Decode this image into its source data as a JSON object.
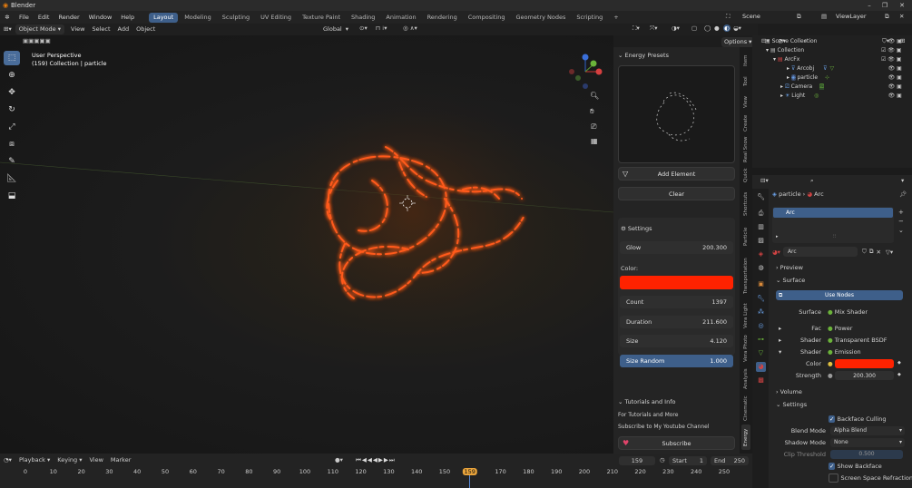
{
  "app": {
    "title": "Blender"
  },
  "menu": [
    "File",
    "Edit",
    "Render",
    "Window",
    "Help"
  ],
  "workspaces": [
    "Layout",
    "Modeling",
    "Sculpting",
    "UV Editing",
    "Texture Paint",
    "Shading",
    "Animation",
    "Rendering",
    "Compositing",
    "Geometry Nodes",
    "Scripting"
  ],
  "scene": {
    "name": "Scene",
    "viewlayer": "ViewLayer"
  },
  "viewport_header": {
    "mode": "Object Mode",
    "menus": [
      "View",
      "Select",
      "Add",
      "Object"
    ],
    "transform": "Global",
    "options": "Options"
  },
  "viewport": {
    "persp": "User Perspective",
    "collection": "(159) Collection | particle"
  },
  "npanel": {
    "presets_header": "Energy Presets",
    "add_element": "Add Element",
    "clear": "Clear",
    "settings_header": "Settings",
    "glow": {
      "label": "Glow",
      "value": "200.300"
    },
    "color_label": "Color:",
    "color_hex": "#ff2200",
    "count": {
      "label": "Count",
      "value": "1397"
    },
    "duration": {
      "label": "Duration",
      "value": "211.600"
    },
    "size": {
      "label": "Size",
      "value": "4.120"
    },
    "size_random": {
      "label": "Size Random",
      "value": "1.000"
    },
    "tutorials_header": "Tutorials and Info",
    "tutorials_line1": "For Tutorials and More",
    "tutorials_line2": "Subscribe to My Youtube Channel",
    "subscribe": "Subscribe"
  },
  "ntabs": [
    "Item",
    "Tool",
    "View",
    "Create",
    "Real Snow",
    "Quick",
    "Shortcuts",
    "Particle",
    "Transportation",
    "Vera Light",
    "Vera Photo",
    "Analysis",
    "Cinematic",
    "Energy"
  ],
  "outliner": {
    "scene_collection": "Scene Collection",
    "collection": "Collection",
    "arcfx": "ArcFx",
    "arcobj": "Arcobj",
    "particle": "particle",
    "camera": "Camera",
    "light": "Light"
  },
  "properties": {
    "object": "particle",
    "material": "Arc",
    "slot": "Arc",
    "material_field": "Arc",
    "preview": "Preview",
    "surface_section": "Surface",
    "use_nodes": "Use Nodes",
    "surface": {
      "label": "Surface",
      "value": "Mix Shader"
    },
    "fac": {
      "label": "Fac",
      "value": "Power"
    },
    "shader1": {
      "label": "Shader",
      "value": "Transparent BSDF"
    },
    "shader2": {
      "label": "Shader",
      "value": "Emission"
    },
    "color": {
      "label": "Color",
      "hex": "#ff2200"
    },
    "strength": {
      "label": "Strength",
      "value": "200.300"
    },
    "volume": "Volume",
    "settings": "Settings",
    "backface_culling": "Backface Culling",
    "blend_mode": {
      "label": "Blend Mode",
      "value": "Alpha Blend"
    },
    "shadow_mode": {
      "label": "Shadow Mode",
      "value": "None"
    },
    "clip_threshold": {
      "label": "Clip Threshold",
      "value": "0.500"
    },
    "show_backface": "Show Backface",
    "ssr": "Screen Space Refraction"
  },
  "timeline": {
    "menus": [
      "Playback",
      "Keying",
      "View",
      "Marker"
    ],
    "current_frame": "159",
    "start_label": "Start",
    "start": "1",
    "end_label": "End",
    "end": "250",
    "ticks": [
      "0",
      "10",
      "20",
      "30",
      "40",
      "50",
      "60",
      "70",
      "80",
      "90",
      "100",
      "110",
      "120",
      "130",
      "140",
      "150",
      "159",
      "170",
      "180",
      "190",
      "200",
      "210",
      "220",
      "230",
      "240",
      "250"
    ]
  },
  "colors": {
    "accent": "#3e5f8a",
    "energy": "#ff2200",
    "frame": "#e8a33b"
  }
}
